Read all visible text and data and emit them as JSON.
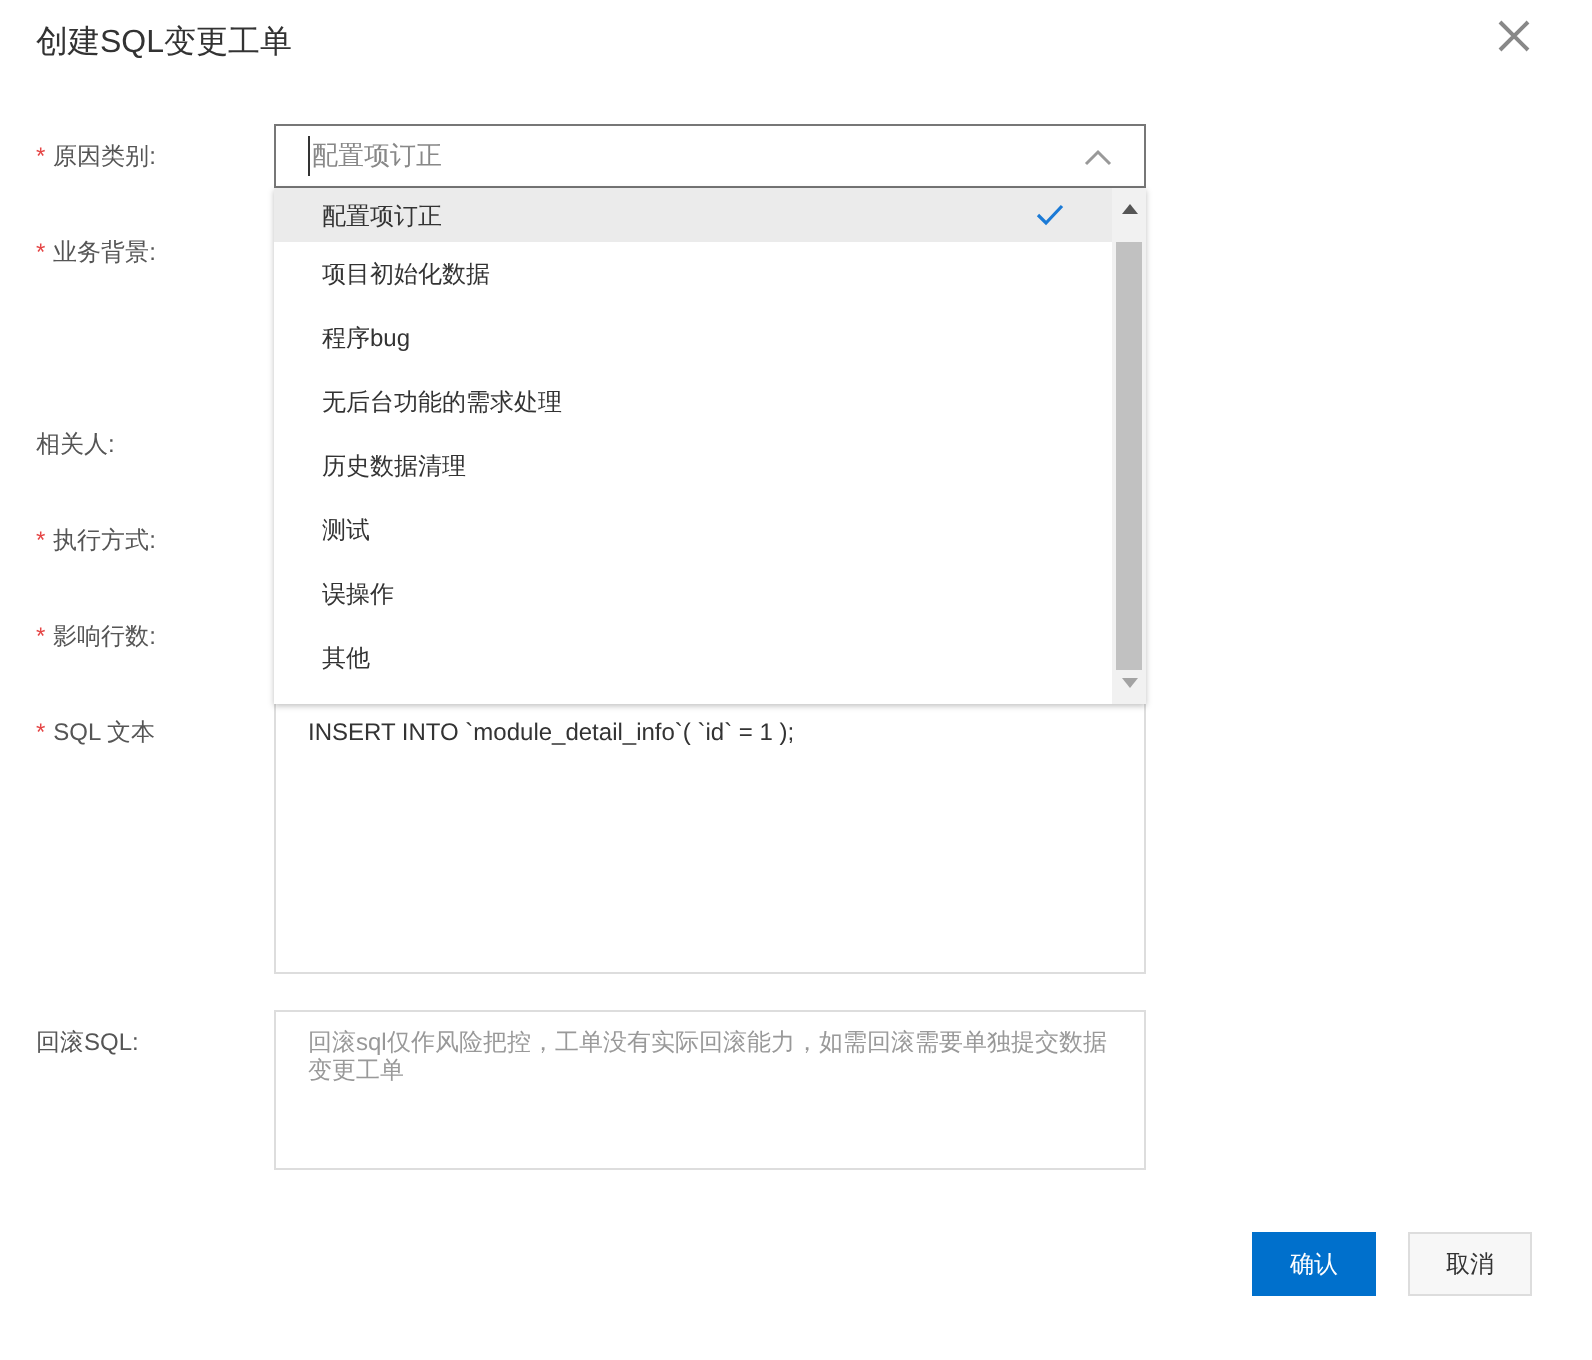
{
  "dialog": {
    "title": "创建SQL变更工单"
  },
  "fields": [
    {
      "label": "原因类别:",
      "required_mark": "*",
      "kind": "select",
      "placeholder": "配置项订正",
      "expanded": true,
      "options": [
        {
          "label": "配置项订正",
          "selected": true
        },
        {
          "label": "项目初始化数据",
          "selected": false
        },
        {
          "label": "程序bug",
          "selected": false
        },
        {
          "label": "无后台功能的需求处理",
          "selected": false
        },
        {
          "label": "历史数据清理",
          "selected": false
        },
        {
          "label": "测试",
          "selected": false
        },
        {
          "label": "误操作",
          "selected": false
        },
        {
          "label": "其他",
          "selected": false
        }
      ]
    },
    {
      "label": "业务背景:",
      "required_mark": "*",
      "kind": "hidden"
    },
    {
      "label": "相关人:",
      "kind": "hidden"
    },
    {
      "label": "执行方式:",
      "required_mark": "*",
      "kind": "hidden"
    },
    {
      "label": "影响行数:",
      "required_mark": "*",
      "kind": "hidden"
    },
    {
      "label": "SQL 文本",
      "required_mark": "*",
      "kind": "textarea",
      "value": "INSERT INTO `module_detail_info`( `id` = 1 );"
    },
    {
      "label": "回滚SQL:",
      "kind": "textarea",
      "placeholder": "回滚sql仅作风险把控，工单没有实际回滚能力，如需回滚需要单独提交数据变更工单"
    }
  ],
  "buttons": [
    {
      "label": "确认",
      "kind": "primary"
    },
    {
      "label": "取消",
      "kind": "default"
    }
  ]
}
